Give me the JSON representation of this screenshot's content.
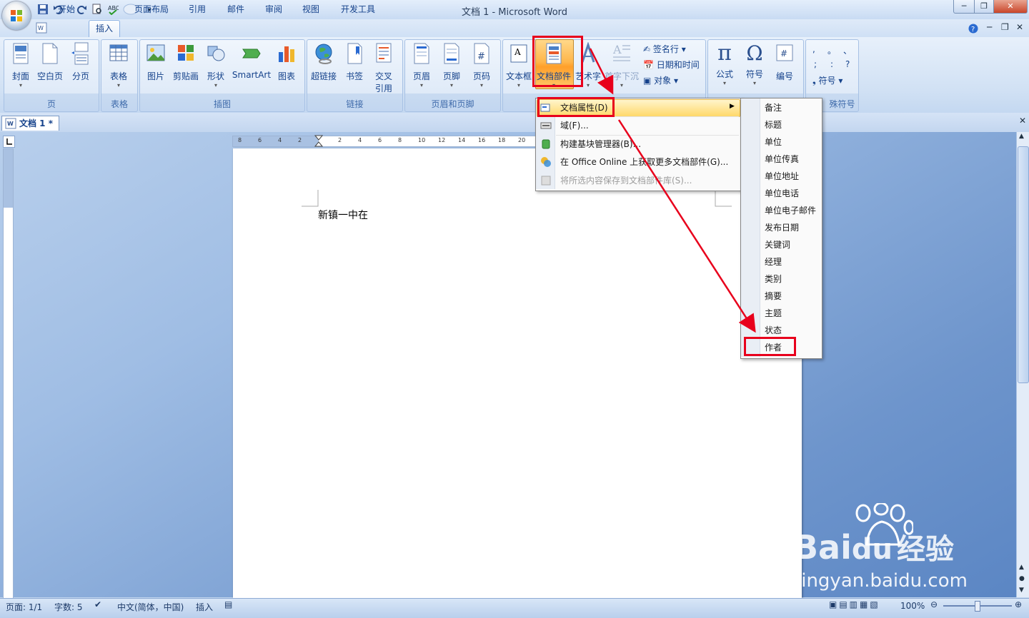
{
  "window": {
    "title": "文档 1 - Microsoft Word"
  },
  "tabs": [
    {
      "label": "开始"
    },
    {
      "label": "插入",
      "active": true
    },
    {
      "label": "页面布局"
    },
    {
      "label": "引用"
    },
    {
      "label": "邮件"
    },
    {
      "label": "审阅"
    },
    {
      "label": "视图"
    },
    {
      "label": "开发工具"
    }
  ],
  "ribbon": {
    "groups": {
      "page": "页",
      "table": "表格",
      "illustrations": "插图",
      "links": "链接",
      "header_footer": "页眉和页脚",
      "special_symbols_partial": "殊符号"
    },
    "buttons": {
      "cover": "封面",
      "blank_page": "空白页",
      "page_break": "分页",
      "table": "表格",
      "picture": "图片",
      "clipart": "剪贴画",
      "shapes": "形状",
      "smartart": "SmartArt",
      "chart": "图表",
      "hyperlink": "超链接",
      "bookmark": "书签",
      "cross_ref_1": "交叉",
      "cross_ref_2": "引用",
      "header": "页眉",
      "footer": "页脚",
      "page_number": "页码",
      "textbox": "文本框",
      "quick_parts": "文档部件",
      "wordart": "艺术字",
      "dropcap": "首字下沉",
      "signature": "签名行",
      "datetime": "日期和时间",
      "object": "对象",
      "equation": "公式",
      "symbol": "符号",
      "number": "编号",
      "symbol_small": "符号"
    },
    "punct": [
      ",",
      "。",
      "、",
      ";",
      ":",
      "?"
    ]
  },
  "document": {
    "tab_label": "文档 1 *",
    "text": "新镇一中在",
    "ruler_ticks": [
      "8",
      "6",
      "4",
      "2",
      "2",
      "4",
      "6",
      "8",
      "10",
      "12",
      "14",
      "16",
      "18",
      "20"
    ]
  },
  "menu": {
    "items": [
      {
        "label": "文档属性(D)",
        "highlighted": true,
        "has_submenu": true
      },
      {
        "label": "域(F)..."
      },
      {
        "label": "构建基块管理器(B)..."
      },
      {
        "label": "在 Office Online 上获取更多文档部件(G)..."
      },
      {
        "label": "将所选内容保存到文档部件库(S)...",
        "disabled": true
      }
    ]
  },
  "submenu": {
    "items": [
      "备注",
      "标题",
      "单位",
      "单位传真",
      "单位地址",
      "单位电话",
      "单位电子邮件",
      "发布日期",
      "关键词",
      "经理",
      "类别",
      "摘要",
      "主题",
      "状态",
      "作者"
    ]
  },
  "statusbar": {
    "page": "页面: 1/1",
    "words": "字数: 5",
    "language": "中文(简体，中国)",
    "mode": "插入",
    "zoom": "100%"
  },
  "watermark": {
    "brand": "Bai",
    "brand2": "du",
    "cn": "经验",
    "url": "jingyan.baidu.com"
  },
  "colors": {
    "highlight_red": "#e8001c",
    "ribbon_text": "#15428b"
  }
}
